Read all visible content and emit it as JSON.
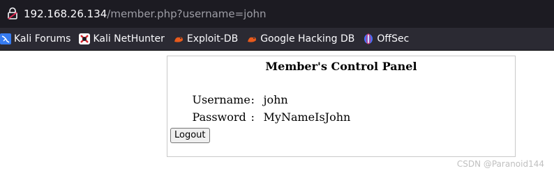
{
  "address_bar": {
    "host": "192.168.26.134",
    "path": "/member.php?username=john"
  },
  "bookmarks": [
    {
      "label": "Kali Forums",
      "icon": "kali-icon"
    },
    {
      "label": "Kali NetHunter",
      "icon": "nethunter-icon"
    },
    {
      "label": "Exploit-DB",
      "icon": "exploit-db-icon"
    },
    {
      "label": "Google Hacking DB",
      "icon": "ghdb-icon"
    },
    {
      "label": "OffSec",
      "icon": "offsec-icon"
    }
  ],
  "panel": {
    "title": "Member's Control Panel",
    "username_label": "Username",
    "username_value": "john",
    "password_label": "Password",
    "password_value": "MyNameIsJohn",
    "logout_label": "Logout"
  },
  "watermark": "CSDN @Paranoid144",
  "colors": {
    "toolbar_bg": "#1c1b22",
    "bookmarks_bg": "#2b2a33",
    "url_host": "#fbfbfe",
    "url_path": "#9e9ea6"
  }
}
